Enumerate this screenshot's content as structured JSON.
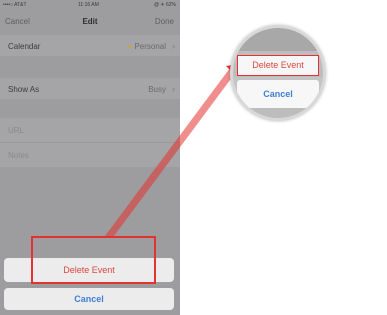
{
  "status_bar": {
    "carrier": "••••○ AT&T",
    "time": "11:16 AM",
    "right": "@ ✈ 62%"
  },
  "navbar": {
    "cancel": "Cancel",
    "title": "Edit",
    "done": "Done"
  },
  "rows": {
    "calendar": {
      "label": "Calendar",
      "value": "Personal",
      "chevron": "›"
    },
    "show_as": {
      "label": "Show As",
      "value": "Busy",
      "chevron": "›"
    },
    "url": {
      "label": "URL"
    },
    "notes": {
      "label": "Notes"
    }
  },
  "action_sheet": {
    "delete": "Delete Event",
    "cancel": "Cancel"
  },
  "zoom": {
    "delete": "Delete Event",
    "cancel": "Cancel"
  },
  "colors": {
    "delete_red": "#d9473e",
    "cancel_blue": "#3f7fd4",
    "highlight_red": "#e3322f",
    "calendar_dot": "#c9a73f"
  }
}
